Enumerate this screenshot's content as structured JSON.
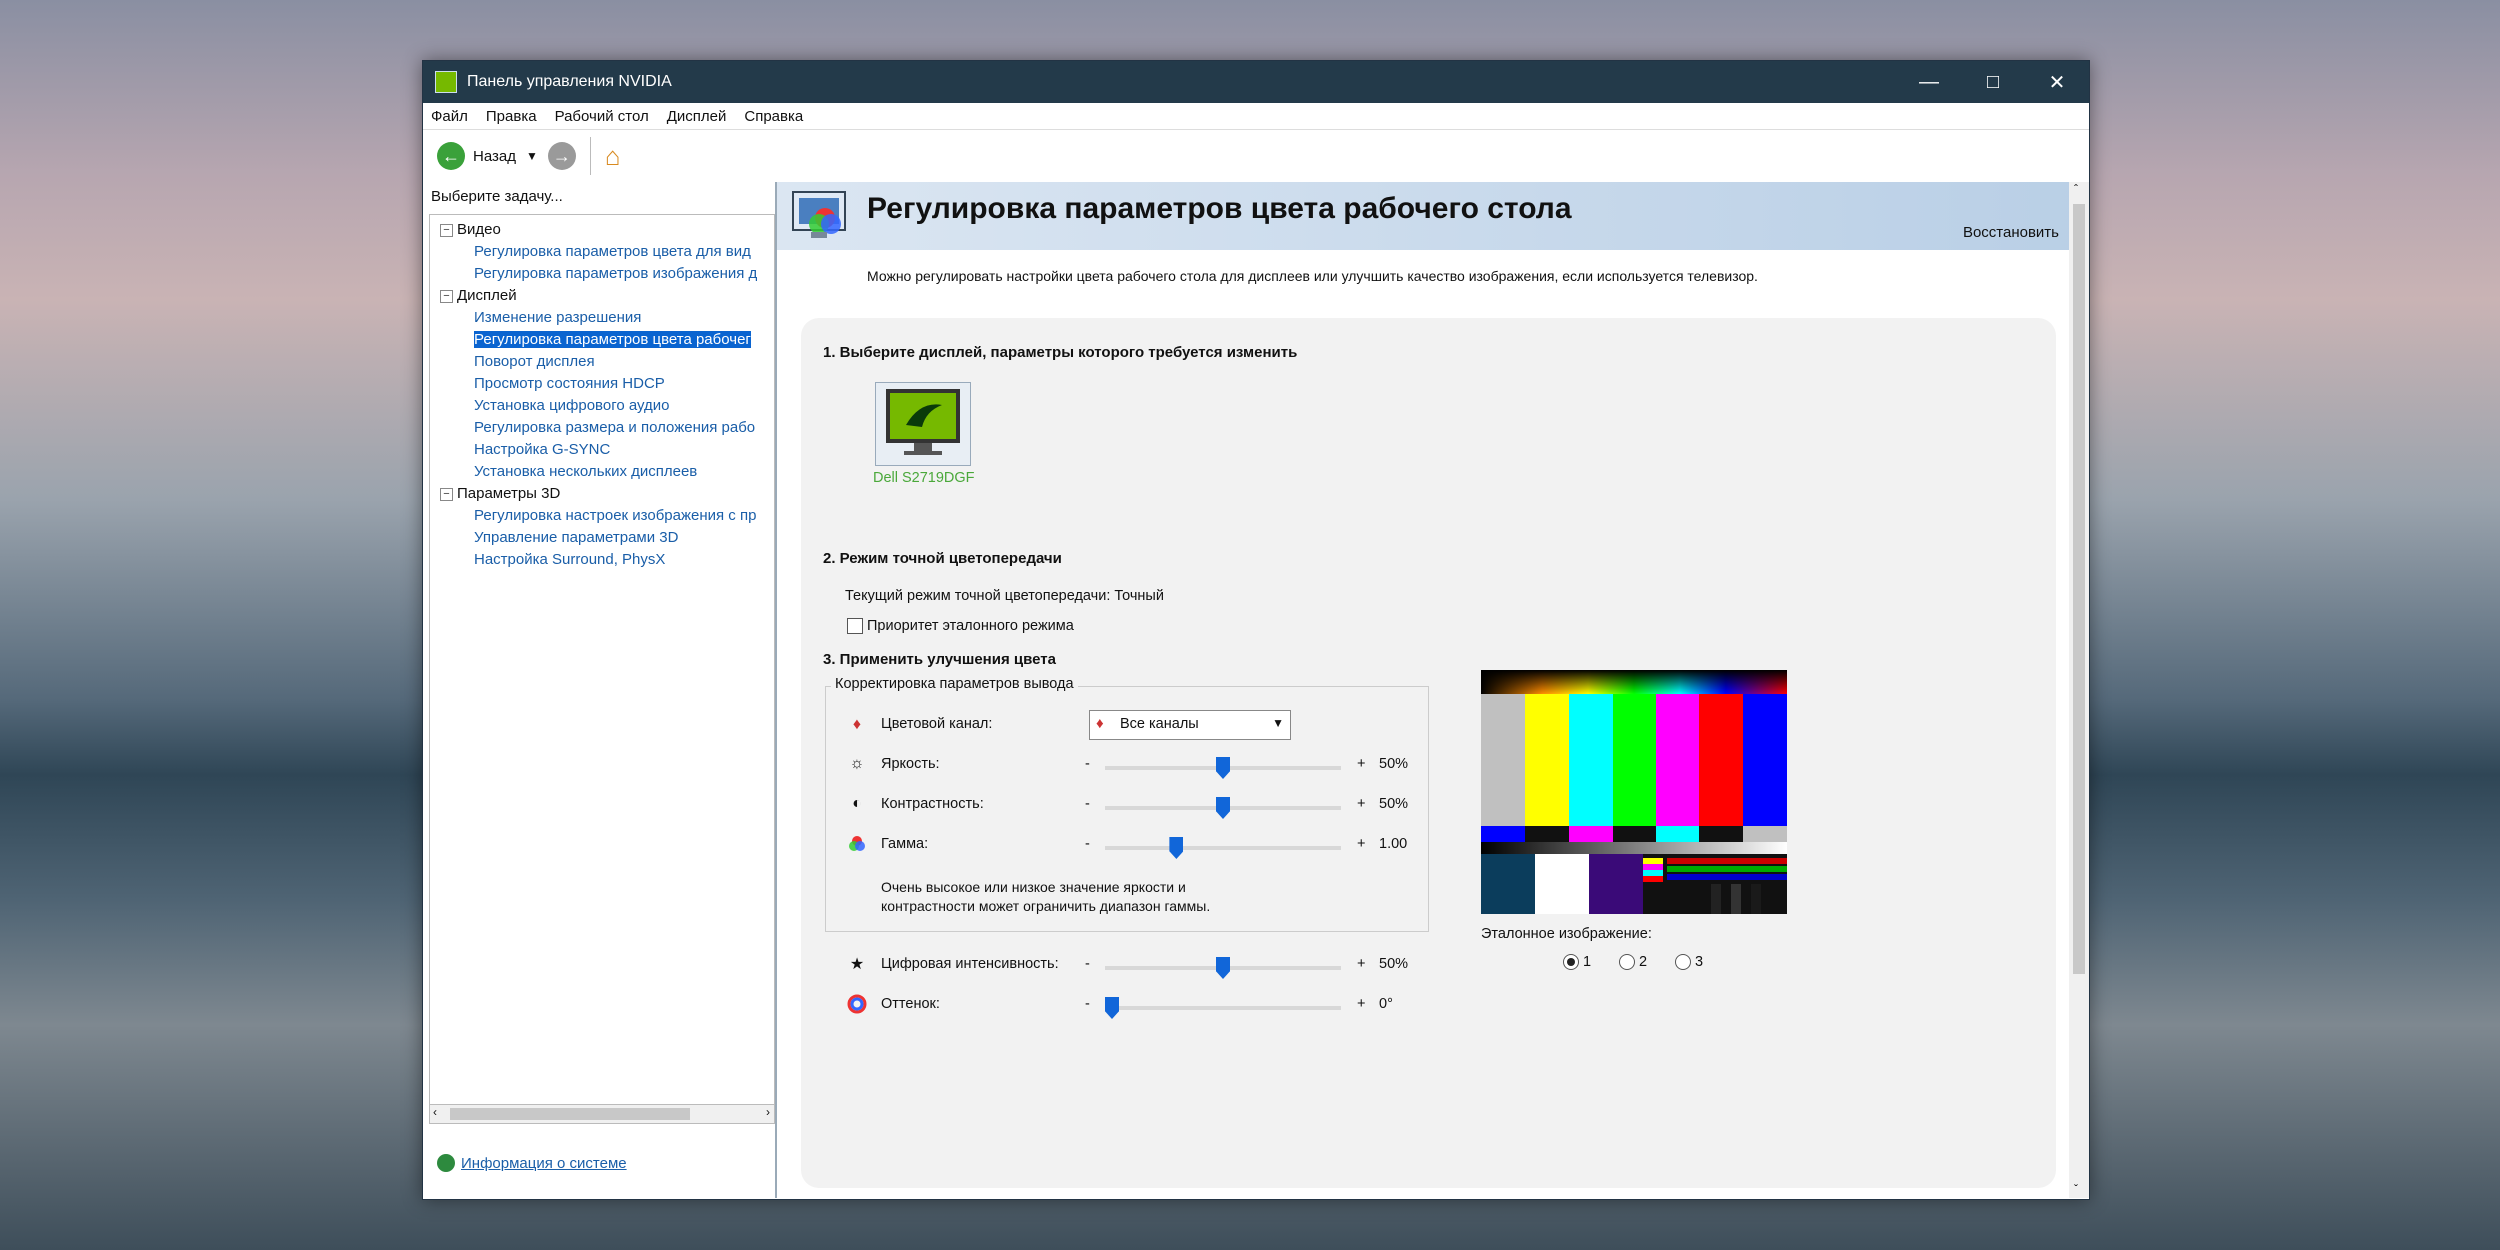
{
  "window": {
    "title": "Панель управления NVIDIA"
  },
  "menu": [
    "Файл",
    "Правка",
    "Рабочий стол",
    "Дисплей",
    "Справка"
  ],
  "toolbar": {
    "back_label": "Назад"
  },
  "left": {
    "prompt": "Выберите задачу...",
    "tree": [
      {
        "label": "Видео",
        "type": "group"
      },
      {
        "label": "Регулировка параметров цвета для вид",
        "type": "leaf"
      },
      {
        "label": "Регулировка параметров изображения д",
        "type": "leaf"
      },
      {
        "label": "Дисплей",
        "type": "group"
      },
      {
        "label": "Изменение разрешения",
        "type": "leaf"
      },
      {
        "label": "Регулировка параметров цвета рабочег",
        "type": "leaf",
        "selected": true
      },
      {
        "label": "Поворот дисплея",
        "type": "leaf"
      },
      {
        "label": "Просмотр состояния HDCP",
        "type": "leaf"
      },
      {
        "label": "Установка цифрового аудио",
        "type": "leaf"
      },
      {
        "label": "Регулировка размера и положения рабо",
        "type": "leaf"
      },
      {
        "label": "Настройка G-SYNC",
        "type": "leaf"
      },
      {
        "label": "Установка нескольких дисплеев",
        "type": "leaf"
      },
      {
        "label": "Параметры 3D",
        "type": "group"
      },
      {
        "label": "Регулировка настроек изображения с пр",
        "type": "leaf"
      },
      {
        "label": "Управление параметрами 3D",
        "type": "leaf"
      },
      {
        "label": "Настройка Surround, PhysX",
        "type": "leaf"
      }
    ],
    "system_info": "Информация о системе"
  },
  "page": {
    "title": "Регулировка параметров цвета рабочего стола",
    "restore": "Восстановить",
    "description": "Можно регулировать настройки цвета рабочего стола для дисплеев или улучшить качество изображения, если используется телевизор.",
    "section1": "1. Выберите дисплей, параметры которого требуется изменить",
    "display_name": "Dell S2719DGF",
    "section2": "2. Режим точной цветопередачи",
    "current_mode": "Текущий режим точной цветопередачи: Точный",
    "reference_priority": "Приоритет эталонного режима",
    "section3": "3. Применить улучшения цвета",
    "group_label": "Корректировка параметров вывода",
    "channel_label": "Цветовой канал:",
    "channel_value": "Все каналы",
    "brightness": {
      "label": "Яркость:",
      "value": "50%",
      "level": 0.5
    },
    "contrast": {
      "label": "Контрастность:",
      "value": "50%",
      "level": 0.5
    },
    "gamma": {
      "label": "Гамма:",
      "value": "1.00",
      "level": 0.29
    },
    "note": "Очень высокое или низкое значение яркости и контрастности может ограничить диапазон гаммы.",
    "vibrance": {
      "label": "Цифровая интенсивность:",
      "value": "50%",
      "level": 0.5
    },
    "hue": {
      "label": "Оттенок:",
      "value": "0°",
      "level": 0.0
    },
    "minus": "-",
    "plus": "+",
    "reference_image_label": "Эталонное изображение:",
    "reference_options": [
      "1",
      "2",
      "3"
    ]
  },
  "colors": {
    "accent": "#76b900",
    "selection": "#0a64d0",
    "link": "#1a5ea8",
    "slider": "#1166d9"
  }
}
